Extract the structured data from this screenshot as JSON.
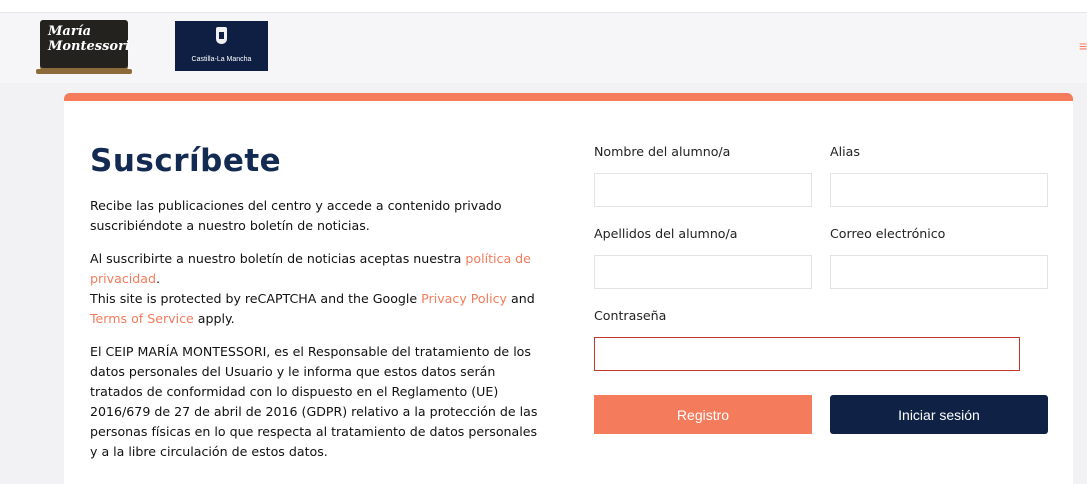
{
  "header": {
    "logo_montessori_line1": "María",
    "logo_montessori_line2": "Montessori",
    "logo_clm_text": "Castilla-La Mancha",
    "menu_icon": "hamburger-menu-icon",
    "menu_glyph": "≡"
  },
  "colors": {
    "accent": "#f47b5c",
    "navy": "#132a53",
    "button_dark": "#0f2245"
  },
  "subscribe": {
    "title": "Suscríbete",
    "intro": "Recibe las publicaciones del centro y accede a contenido privado suscribiéndote a nuestro boletín de noticias.",
    "policy_prefix": "Al suscribirte a nuestro boletín de noticias aceptas nuestra ",
    "policy_link": "política de privacidad",
    "policy_suffix": ".",
    "recaptcha_prefix": "This site is protected by reCAPTCHA and the Google ",
    "privacy_link": "Privacy Policy",
    "recaptcha_and": " and ",
    "terms_link": "Terms of Service",
    "recaptcha_suffix": " apply.",
    "legal": "El CEIP MARÍA MONTESSORI, es el Responsable del tratamiento de los datos personales del Usuario y le informa que estos datos serán tratados de conformidad con lo dispuesto en el Reglamento (UE) 2016/679 de 27 de abril de 2016 (GDPR) relativo a la protección de las personas físicas en lo que respecta al tratamiento de datos personales y a la libre circulación de estos datos."
  },
  "form": {
    "nombre_label": "Nombre del alumno/a",
    "nombre_value": "",
    "alias_label": "Alias",
    "alias_value": "",
    "apellidos_label": "Apellidos del alumno/a",
    "apellidos_value": "",
    "correo_label": "Correo electrónico",
    "correo_value": "",
    "contrasena_label": "Contraseña",
    "contrasena_value": "",
    "registro_button": "Registro",
    "login_button": "Iniciar sesión"
  }
}
